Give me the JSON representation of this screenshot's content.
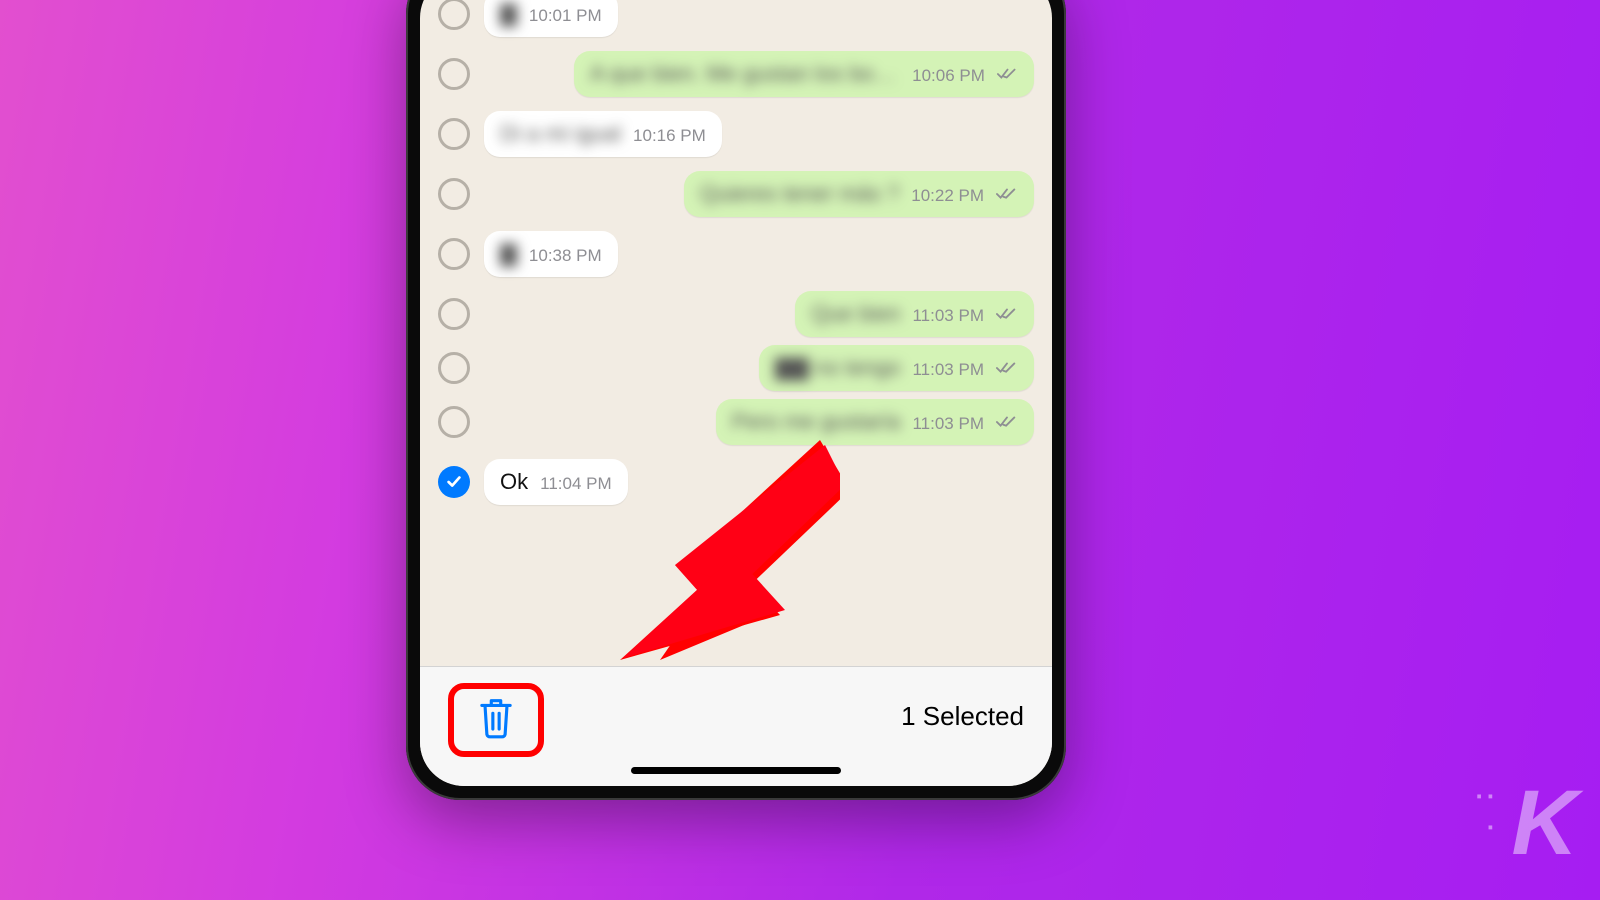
{
  "messages": [
    {
      "dir": "in",
      "text": "▇",
      "time": "10:01 PM",
      "blur": true,
      "selected": false,
      "ticks": false
    },
    {
      "dir": "out",
      "text": "A que bien. Me gustan los bolsos",
      "time": "10:06 PM",
      "blur": true,
      "selected": false,
      "ticks": true
    },
    {
      "dir": "in",
      "text": "Di a mi igual",
      "time": "10:16 PM",
      "blur": true,
      "selected": false,
      "ticks": false
    },
    {
      "dir": "out",
      "text": "Quieres tener más ?",
      "time": "10:22 PM",
      "blur": true,
      "selected": false,
      "ticks": true
    },
    {
      "dir": "in",
      "text": "▇",
      "time": "10:38 PM",
      "blur": true,
      "selected": false,
      "ticks": false
    },
    {
      "dir": "out",
      "text": "Que bien",
      "time": "11:03 PM",
      "blur": true,
      "selected": false,
      "ticks": true
    },
    {
      "dir": "out",
      "text": "▇▇ no tengo",
      "time": "11:03 PM",
      "blur": true,
      "selected": false,
      "ticks": true
    },
    {
      "dir": "out",
      "text": "Pero me gustaría",
      "time": "11:03 PM",
      "blur": true,
      "selected": false,
      "ticks": true
    },
    {
      "dir": "in",
      "text": "Ok",
      "time": "11:04 PM",
      "blur": false,
      "selected": true,
      "ticks": false
    }
  ],
  "toolbar": {
    "selected_label": "1 Selected"
  },
  "watermark": "K"
}
